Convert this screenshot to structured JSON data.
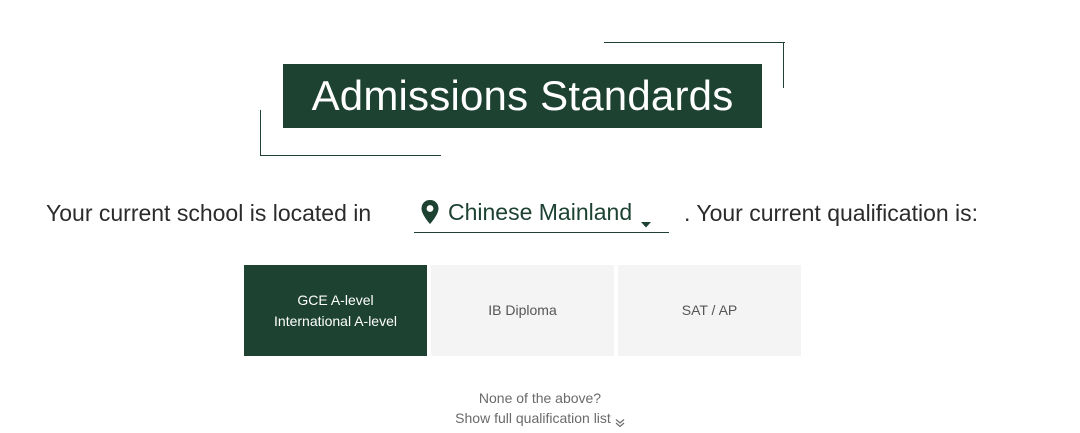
{
  "header": {
    "title": "Admissions Standards"
  },
  "location": {
    "prefix": "Your current school is located in",
    "selected": "Chinese Mainland",
    "suffix": ". Your current qualification is:",
    "pin_icon": "map-pin-icon",
    "caret_icon": "caret-down-icon"
  },
  "qualifications": {
    "tabs": [
      {
        "lines": [
          "GCE A-level",
          "International A-level"
        ],
        "active": true
      },
      {
        "lines": [
          "IB Diploma"
        ],
        "active": false
      },
      {
        "lines": [
          "SAT / AP"
        ],
        "active": false
      }
    ]
  },
  "footer": {
    "question": "None of the above?",
    "show_list": "Show full qualification list",
    "chevron_icon": "double-chevron-down-icon"
  },
  "colors": {
    "brand": "#1d4232",
    "tab_inactive_bg": "#f4f4f4",
    "background": "#ffffff"
  }
}
